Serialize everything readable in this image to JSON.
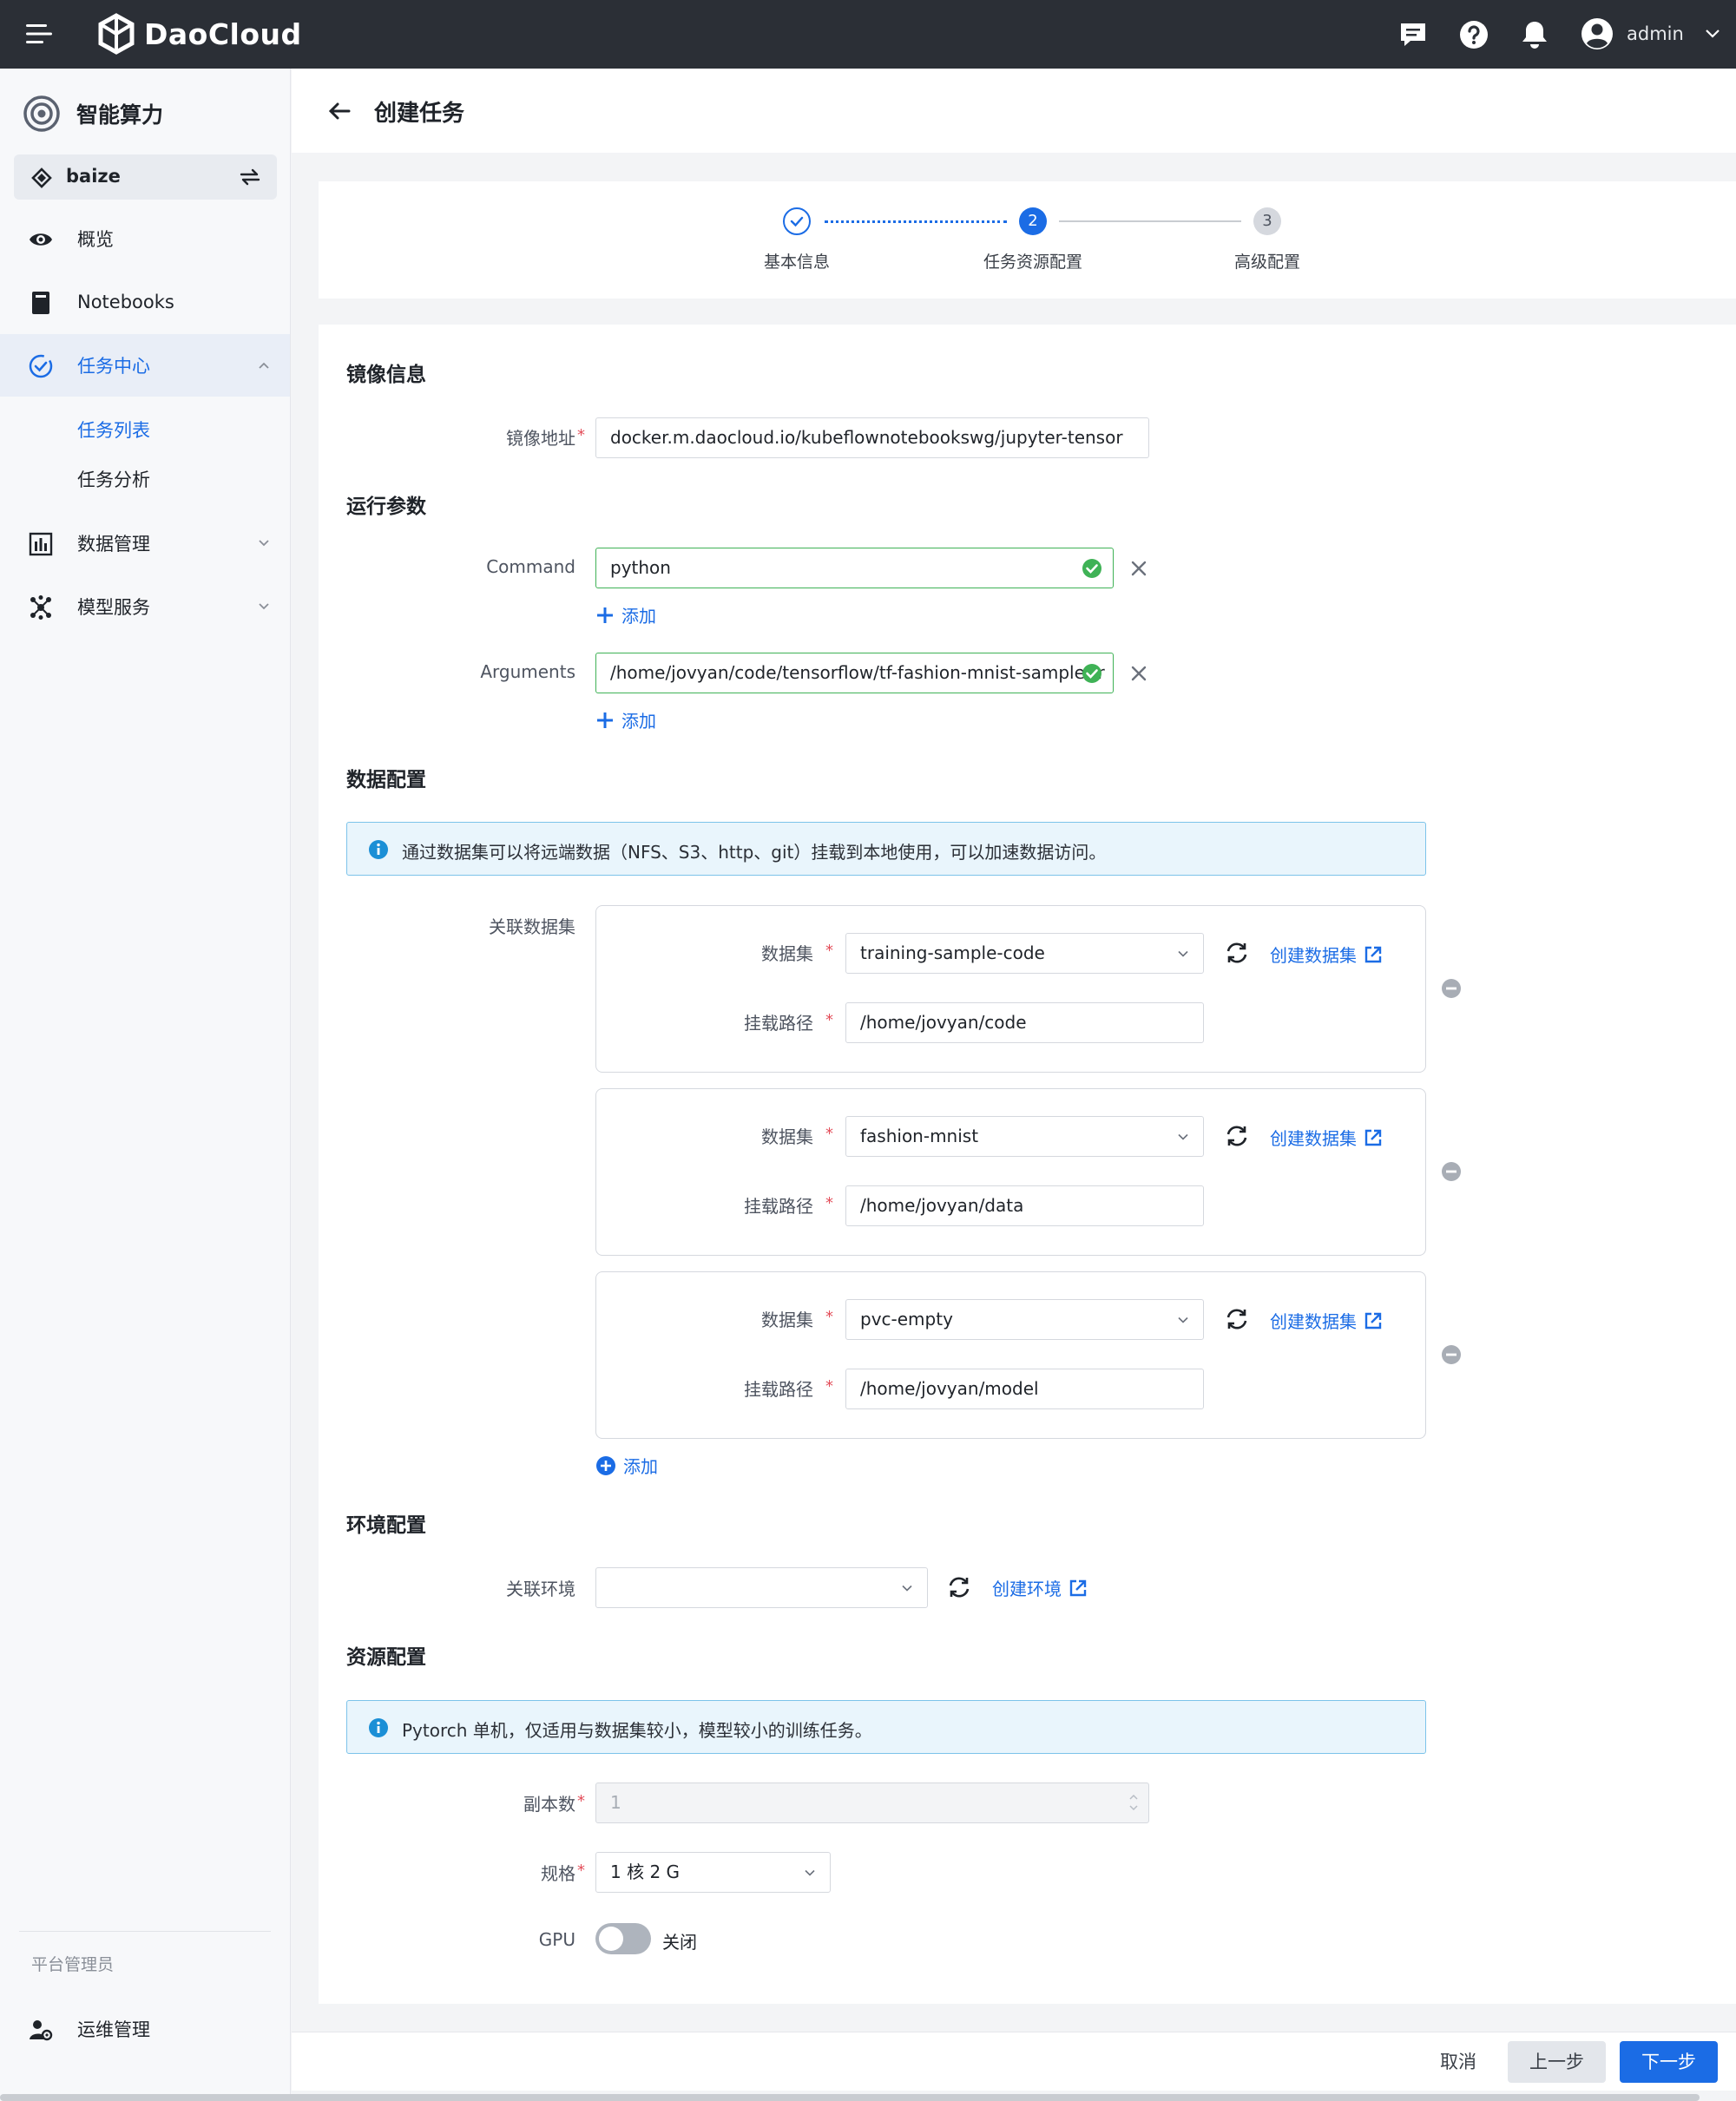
{
  "topbar": {
    "brand": "DaoCloud",
    "user": "admin"
  },
  "sidebar": {
    "title": "智能算力",
    "workspace": "baize",
    "items": [
      {
        "label": "概览"
      },
      {
        "label": "Notebooks"
      },
      {
        "label": "任务中心"
      },
      {
        "label": "数据管理"
      },
      {
        "label": "模型服务"
      }
    ],
    "subitems": [
      {
        "label": "任务列表",
        "active": true
      },
      {
        "label": "任务分析",
        "active": false
      }
    ],
    "section_label": "平台管理员",
    "ops_label": "运维管理"
  },
  "page": {
    "title": "创建任务"
  },
  "steps": [
    {
      "number": "1",
      "label": "基本信息",
      "status": "done"
    },
    {
      "number": "2",
      "label": "任务资源配置",
      "status": "current"
    },
    {
      "number": "3",
      "label": "高级配置",
      "status": "pending"
    }
  ],
  "form": {
    "image_section": "镜像信息",
    "image_label": "镜像地址",
    "image_value": "docker.m.daocloud.io/kubeflownotebookswg/jupyter-tensor",
    "run_section": "运行参数",
    "command_label": "Command",
    "command_value": "python",
    "args_label": "Arguments",
    "args_value": "/home/jovyan/code/tensorflow/tf-fashion-mnist-sample/tr",
    "add_label": "添加",
    "data_section": "数据配置",
    "data_alert": "通过数据集可以将远端数据（NFS、S3、http、git）挂载到本地使用，可以加速数据访问。",
    "datasets_label": "关联数据集",
    "dataset_label": "数据集",
    "mount_label": "挂载路径",
    "create_dataset": "创建数据集",
    "datasets": [
      {
        "name": "training-sample-code",
        "path": "/home/jovyan/code"
      },
      {
        "name": "fashion-mnist",
        "path": "/home/jovyan/data"
      },
      {
        "name": "pvc-empty",
        "path": "/home/jovyan/model"
      }
    ],
    "env_section": "环境配置",
    "env_label": "关联环境",
    "env_value": "",
    "create_env": "创建环境",
    "resource_section": "资源配置",
    "resource_alert": "Pytorch 单机，仅适用与数据集较小，模型较小的训练任务。",
    "replicas_label": "副本数",
    "replicas_value": "1",
    "spec_label": "规格",
    "spec_value": "1 核 2 G",
    "gpu_label": "GPU",
    "gpu_state": "关闭"
  },
  "footer": {
    "cancel": "取消",
    "prev": "上一步",
    "next": "下一步"
  },
  "colors": {
    "primary": "#1b6ce5",
    "success": "#3fb256",
    "danger": "#e34d59",
    "topbar": "#2b2f36"
  }
}
